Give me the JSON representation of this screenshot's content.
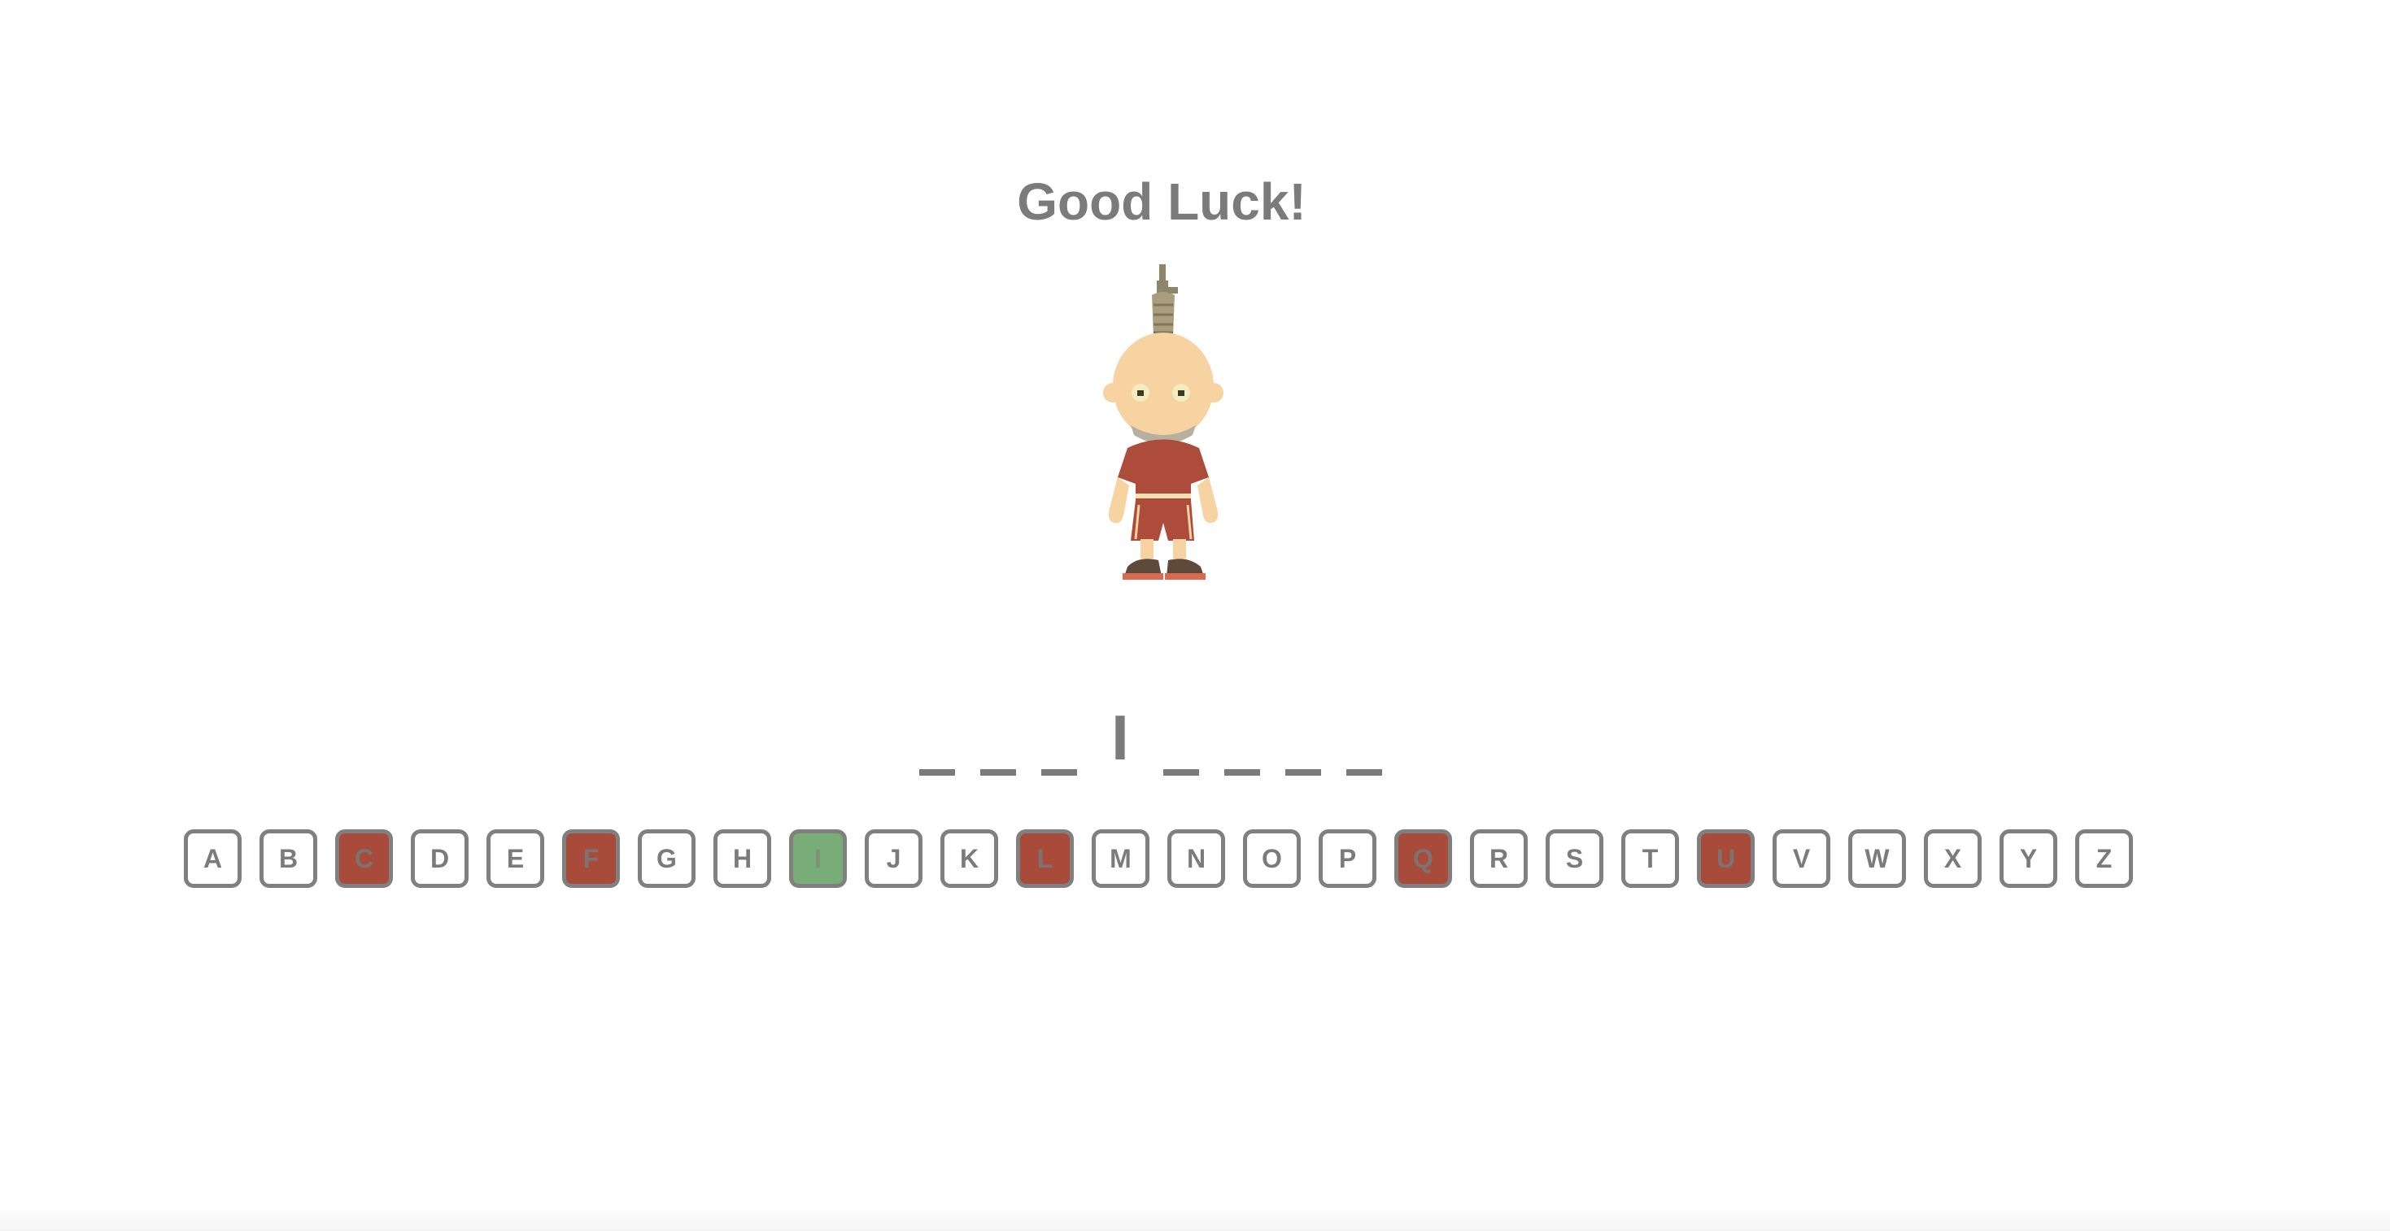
{
  "game": {
    "title": "Good Luck!",
    "word": [
      {
        "char": "",
        "revealed": false
      },
      {
        "char": "",
        "revealed": false
      },
      {
        "char": "",
        "revealed": false
      },
      {
        "char": "I",
        "revealed": true
      },
      {
        "char": "",
        "revealed": false
      },
      {
        "char": "",
        "revealed": false
      },
      {
        "char": "",
        "revealed": false
      },
      {
        "char": "",
        "revealed": false
      }
    ],
    "keys": [
      {
        "letter": "A",
        "state": "unused"
      },
      {
        "letter": "B",
        "state": "unused"
      },
      {
        "letter": "C",
        "state": "wrong"
      },
      {
        "letter": "D",
        "state": "unused"
      },
      {
        "letter": "E",
        "state": "unused"
      },
      {
        "letter": "F",
        "state": "wrong"
      },
      {
        "letter": "G",
        "state": "unused"
      },
      {
        "letter": "H",
        "state": "unused"
      },
      {
        "letter": "I",
        "state": "correct"
      },
      {
        "letter": "J",
        "state": "unused"
      },
      {
        "letter": "K",
        "state": "unused"
      },
      {
        "letter": "L",
        "state": "wrong"
      },
      {
        "letter": "M",
        "state": "unused"
      },
      {
        "letter": "N",
        "state": "unused"
      },
      {
        "letter": "O",
        "state": "unused"
      },
      {
        "letter": "P",
        "state": "unused"
      },
      {
        "letter": "Q",
        "state": "wrong"
      },
      {
        "letter": "R",
        "state": "unused"
      },
      {
        "letter": "S",
        "state": "unused"
      },
      {
        "letter": "T",
        "state": "unused"
      },
      {
        "letter": "U",
        "state": "wrong"
      },
      {
        "letter": "V",
        "state": "unused"
      },
      {
        "letter": "W",
        "state": "unused"
      },
      {
        "letter": "X",
        "state": "unused"
      },
      {
        "letter": "Y",
        "state": "unused"
      },
      {
        "letter": "Z",
        "state": "unused"
      }
    ],
    "figure": {
      "icon": "hangman-figure-icon",
      "parts_shown": 5
    }
  },
  "colors": {
    "text": "#7b7b7b",
    "key_border": "#808080",
    "wrong": "#a84b3a",
    "correct": "#79ad77",
    "skin": "#f6d3a1",
    "shirt": "#ad4c3b",
    "rope": "#a89d7e"
  }
}
